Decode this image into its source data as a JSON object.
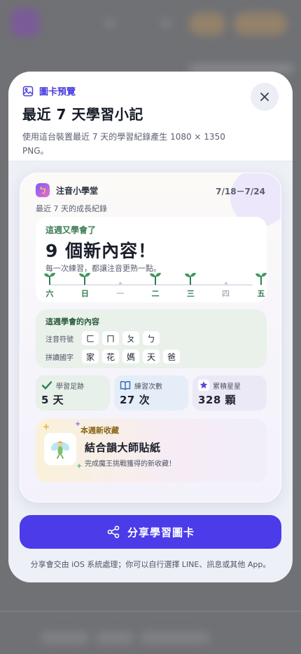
{
  "modal": {
    "eyebrow": "圖卡預覽",
    "title": "最近 7 天學習小記",
    "description": "使用這台裝置最近 7 天的學習紀錄產生 1080 × 1350 PNG。"
  },
  "card": {
    "app_icon_letter": "ㄅ",
    "app_name": "注音小學堂",
    "date_range": "7/18－7/24",
    "subtitle": "最近 7 天的成長紀錄",
    "week": {
      "label": "這週又學會了",
      "count": "9 個新內容！",
      "hint": "每一次練習，都讓注音更熟一點。",
      "days": [
        {
          "label": "六",
          "active": true
        },
        {
          "label": "日",
          "active": true
        },
        {
          "label": "一",
          "active": false
        },
        {
          "label": "二",
          "active": true
        },
        {
          "label": "三",
          "active": true
        },
        {
          "label": "四",
          "active": false
        },
        {
          "label": "五",
          "active": true
        }
      ]
    },
    "learned": {
      "title": "這週學會的內容",
      "zhuyin_label": "注音符號",
      "zhuyin": [
        "ㄈ",
        "ㄇ",
        "ㄆ",
        "ㄅ"
      ],
      "hanzi_label": "拼讀國字",
      "hanzi": [
        "家",
        "花",
        "媽",
        "天",
        "爸"
      ]
    },
    "stats": [
      {
        "label": "學習足跡",
        "value": "5 天",
        "icon": "check-icon"
      },
      {
        "label": "練習次數",
        "value": "27 次",
        "icon": "book-icon"
      },
      {
        "label": "累積星星",
        "value": "328 顆",
        "icon": "star-icon"
      }
    ],
    "collection": {
      "label": "本週新收藏",
      "name": "結合韻大師貼紙",
      "description": "完成魔王挑戰獲得的新收藏！",
      "icon": "fairy-sticker-icon"
    }
  },
  "share_button": "分享學習圖卡",
  "footnote": "分享會交由 iOS 系統處理；你可以自行選擇 LINE、訊息或其他 App。",
  "colors": {
    "accent": "#4b3be8",
    "green": "#2f7d4f",
    "eyebrow": "#4b3fe0"
  }
}
